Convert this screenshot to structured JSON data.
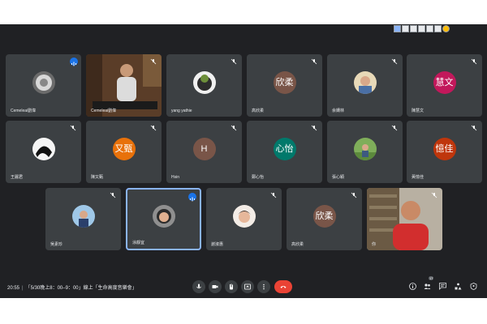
{
  "participants": [
    {
      "name": "Cemeleai劉偉",
      "type": "photo",
      "mic": "on"
    },
    {
      "name": "Cemeleai劉偉",
      "type": "video",
      "mic": "off"
    },
    {
      "name": "yang yathie",
      "type": "photo",
      "mic": "off"
    },
    {
      "name": "高欣柔",
      "type": "initials",
      "initials": "欣柔",
      "color": "#795548",
      "mic": "off"
    },
    {
      "name": "余姍林",
      "type": "photo",
      "mic": "off"
    },
    {
      "name": "陳慧文",
      "type": "initials",
      "initials": "慧文",
      "color": "#c2185b",
      "mic": "off"
    },
    {
      "name": "王麗君",
      "type": "photo",
      "mic": "off"
    },
    {
      "name": "陳又甄",
      "type": "initials",
      "initials": "又甄",
      "color": "#e8710a",
      "mic": "off"
    },
    {
      "name": "Hsin",
      "type": "initials",
      "initials": "H",
      "color": "#795548",
      "mic": "off"
    },
    {
      "name": "鄭心怡",
      "type": "initials",
      "initials": "心怡",
      "color": "#00796b",
      "mic": "off"
    },
    {
      "name": "張心穎",
      "type": "photo",
      "mic": "off"
    },
    {
      "name": "黃憶佳",
      "type": "initials",
      "initials": "憶佳",
      "color": "#bf360c",
      "mic": "off"
    },
    {
      "name": "吳素珍",
      "type": "photo",
      "mic": "off"
    },
    {
      "name": "涂靜宜",
      "type": "photo",
      "mic": "on",
      "speaking": true
    },
    {
      "name": "謝淑惠",
      "type": "photo",
      "mic": "off"
    },
    {
      "name": "高欣柔",
      "type": "initials",
      "initials": "欣柔",
      "color": "#795548",
      "mic": "off"
    },
    {
      "name": "你",
      "type": "video",
      "mic": "off"
    }
  ],
  "meeting": {
    "time": "20:55",
    "title": "「5/30晚上8：00–9：00」線上「生命高度音樂會」"
  },
  "people_count": "17",
  "colors": {
    "background": "#202124",
    "tile": "#3c4043",
    "accent": "#8ab4f8",
    "end_call": "#ea4335"
  },
  "controls": [
    "mic-icon",
    "camera-icon",
    "raise-hand-icon",
    "present-icon",
    "more-options-icon",
    "end-call-icon"
  ],
  "right_icons": [
    "info-icon",
    "people-icon",
    "chat-icon",
    "activities-icon",
    "host-controls-icon"
  ]
}
